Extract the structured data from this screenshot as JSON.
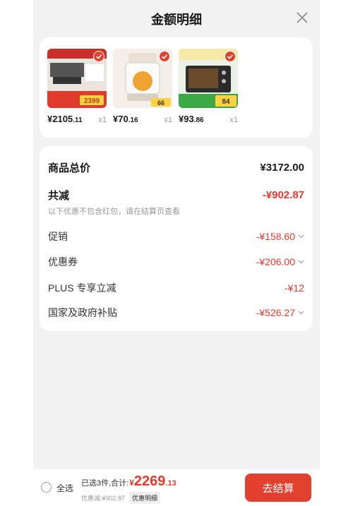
{
  "sheet": {
    "title": "金额明细"
  },
  "products": [
    {
      "price_int": "¥2105",
      "price_dec": ".11",
      "qty": "x1",
      "thumb_price": "2399"
    },
    {
      "price_int": "¥70",
      "price_dec": ".16",
      "qty": "x1",
      "thumb_price": "66"
    },
    {
      "price_int": "¥93",
      "price_dec": ".86",
      "qty": "x1",
      "thumb_price": "84"
    }
  ],
  "breakdown": {
    "total_label": "商品总价",
    "total_value": "¥3172.00",
    "reduce_label": "共减",
    "reduce_value": "-¥902.87",
    "note": "以下优惠不包含红包，请在结算页查看",
    "items": [
      {
        "label": "促销",
        "value": "-¥158.60"
      },
      {
        "label": "优惠券",
        "value": "-¥206.00"
      },
      {
        "label": "PLUS 专享立减",
        "value": "-¥12"
      },
      {
        "label": "国家及政府补贴",
        "value": "-¥526.27"
      }
    ]
  },
  "bottom": {
    "select_all": "全选",
    "summary": "已选3件,合计:",
    "currency": "¥",
    "amount_int": "2269",
    "amount_dec": ".13",
    "discount": "优惠减:¥902.87",
    "detail_tag": "优惠明细",
    "checkout": "去结算"
  },
  "colors": {
    "accent": "#e2402f",
    "price_red": "#e23a2e"
  }
}
